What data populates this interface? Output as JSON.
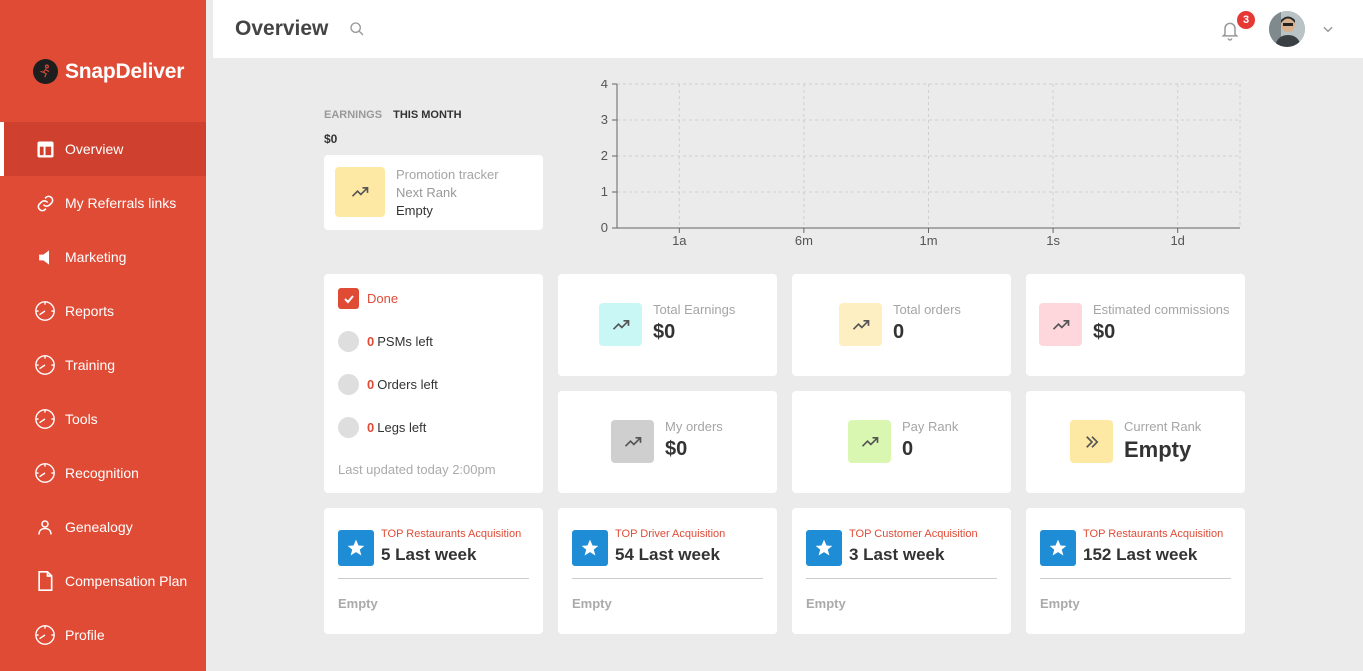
{
  "brand": {
    "name": "SnapDeliver"
  },
  "sidebar": {
    "items": [
      {
        "label": "Overview",
        "icon": "layout-icon"
      },
      {
        "label": "My Referrals links",
        "icon": "link-icon"
      },
      {
        "label": "Marketing",
        "icon": "megaphone-icon"
      },
      {
        "label": "Reports",
        "icon": "gauge-icon"
      },
      {
        "label": "Training",
        "icon": "gauge-icon"
      },
      {
        "label": "Tools",
        "icon": "gauge-icon"
      },
      {
        "label": "Recognition",
        "icon": "gauge-icon"
      },
      {
        "label": "Genealogy",
        "icon": "user-icon"
      },
      {
        "label": "Compensation Plan",
        "icon": "document-icon"
      },
      {
        "label": "Profile",
        "icon": "gauge-icon"
      }
    ]
  },
  "header": {
    "title": "Overview",
    "notification_count": "3"
  },
  "earnings": {
    "tab_earnings": "EARNINGS",
    "tab_this_month": "THIS MONTH",
    "value": "$0"
  },
  "promotion": {
    "title": "Promotion tracker",
    "next_rank_label": "Next Rank",
    "next_rank_value": "Empty"
  },
  "checklist": {
    "done_label": "Done",
    "psms_count": "0",
    "psms_label": "PSMs left",
    "orders_count": "0",
    "orders_label": "Orders left",
    "legs_count": "0",
    "legs_label": "Legs left",
    "updated": "Last updated today 2:00pm"
  },
  "stats": {
    "total_earnings": {
      "label": "Total Earnings",
      "value": "$0"
    },
    "total_orders": {
      "label": "Total orders",
      "value": "0"
    },
    "estimated_commissions": {
      "label": "Estimated commissions",
      "value": "$0"
    },
    "my_orders": {
      "label": "My orders",
      "value": "$0"
    },
    "pay_rank": {
      "label": "Pay Rank",
      "value": "0"
    },
    "current_rank": {
      "label": "Current Rank",
      "value": "Empty"
    }
  },
  "top_cards": [
    {
      "title": "TOP Restaurants Acquisition",
      "value": "5 Last week",
      "empty": "Empty"
    },
    {
      "title": "TOP Driver Acquisition",
      "value": "54 Last week",
      "empty": "Empty"
    },
    {
      "title": "TOP Customer Acquisition",
      "value": "3 Last week",
      "empty": "Empty"
    },
    {
      "title": "TOP Restaurants Acquisition",
      "value": "152 Last week",
      "empty": "Empty"
    }
  ],
  "colors": {
    "sidebar": "#e04b36",
    "accent_red": "#e04b36",
    "star_blue": "#1f8dd6",
    "icon_yellow": "#fde9a4",
    "icon_cyan": "#c9f7f5",
    "icon_pink": "#fdd7dc",
    "icon_gray": "#cfcfcf",
    "icon_green": "#d9f7b0"
  },
  "chart_data": {
    "type": "line",
    "x": [
      "1a",
      "6m",
      "1m",
      "1s",
      "1d"
    ],
    "series": [],
    "yticks": [
      0,
      1,
      2,
      3,
      4
    ],
    "ylim": [
      0,
      4
    ],
    "grid": true
  }
}
